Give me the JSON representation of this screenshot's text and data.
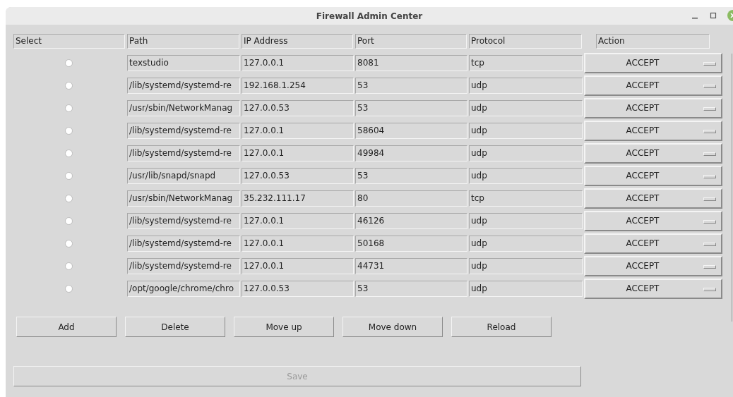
{
  "window": {
    "title": "Firewall Admin Center"
  },
  "table": {
    "columns": [
      "Select",
      "Path",
      "IP Address",
      "Port",
      "Protocol",
      "Action"
    ],
    "rows": [
      {
        "selected": false,
        "path": "texstudio",
        "ip": "127.0.0.1",
        "port": "8081",
        "protocol": "tcp",
        "action": "ACCEPT"
      },
      {
        "selected": false,
        "path": "/lib/systemd/systemd-re",
        "ip": "192.168.1.254",
        "port": "53",
        "protocol": "udp",
        "action": "ACCEPT"
      },
      {
        "selected": false,
        "path": "/usr/sbin/NetworkManag",
        "ip": "127.0.0.53",
        "port": "53",
        "protocol": "udp",
        "action": "ACCEPT"
      },
      {
        "selected": false,
        "path": "/lib/systemd/systemd-re",
        "ip": "127.0.0.1",
        "port": "58604",
        "protocol": "udp",
        "action": "ACCEPT"
      },
      {
        "selected": false,
        "path": "/lib/systemd/systemd-re",
        "ip": "127.0.0.1",
        "port": "49984",
        "protocol": "udp",
        "action": "ACCEPT"
      },
      {
        "selected": false,
        "path": "/usr/lib/snapd/snapd",
        "ip": "127.0.0.53",
        "port": "53",
        "protocol": "udp",
        "action": "ACCEPT"
      },
      {
        "selected": false,
        "path": "/usr/sbin/NetworkManag",
        "ip": "35.232.111.17",
        "port": "80",
        "protocol": "tcp",
        "action": "ACCEPT"
      },
      {
        "selected": false,
        "path": "/lib/systemd/systemd-re",
        "ip": "127.0.0.1",
        "port": "46126",
        "protocol": "udp",
        "action": "ACCEPT"
      },
      {
        "selected": false,
        "path": "/lib/systemd/systemd-re",
        "ip": "127.0.0.1",
        "port": "50168",
        "protocol": "udp",
        "action": "ACCEPT"
      },
      {
        "selected": false,
        "path": "/lib/systemd/systemd-re",
        "ip": "127.0.0.1",
        "port": "44731",
        "protocol": "udp",
        "action": "ACCEPT"
      },
      {
        "selected": false,
        "path": "/opt/google/chrome/chro",
        "ip": "127.0.0.53",
        "port": "53",
        "protocol": "udp",
        "action": "ACCEPT"
      }
    ]
  },
  "buttons": [
    "Add",
    "Delete",
    "Move up",
    "Move down",
    "Reload"
  ],
  "save": {
    "label": "Save",
    "disabled": true
  }
}
